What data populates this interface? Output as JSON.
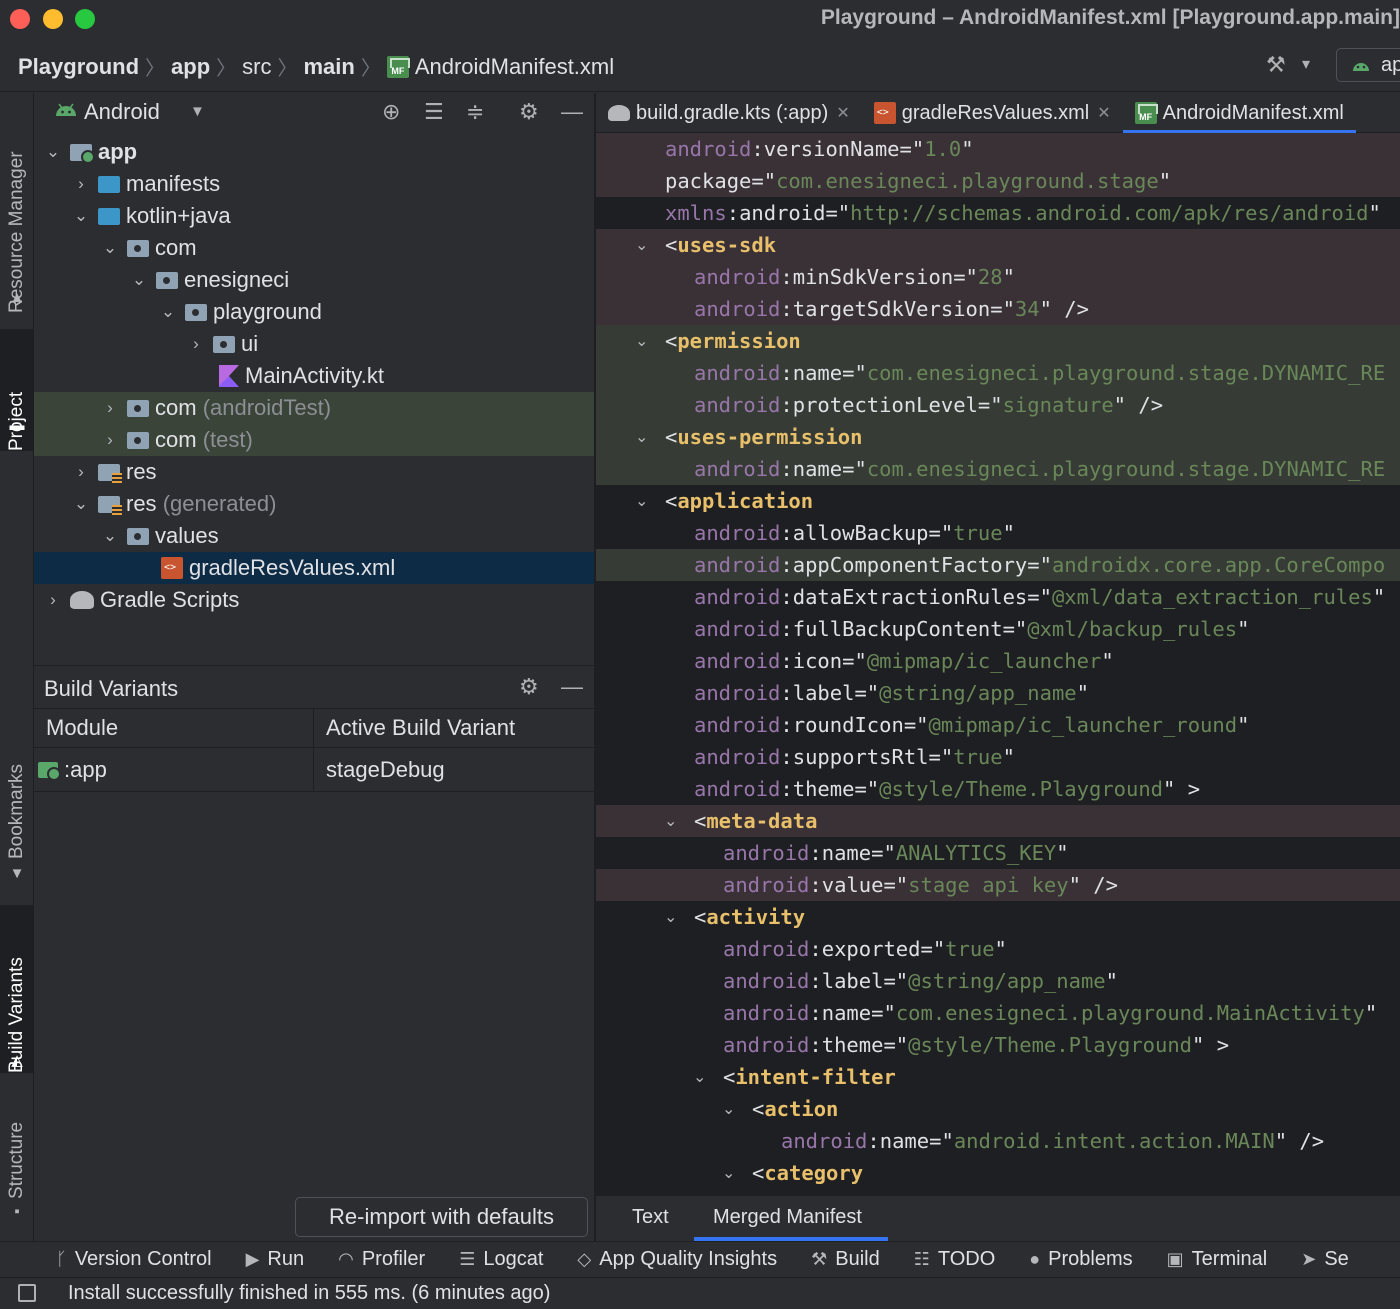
{
  "window": {
    "title": "Playground – AndroidManifest.xml [Playground.app.main]"
  },
  "breadcrumb": [
    "Playground",
    "app",
    "src",
    "main",
    "AndroidManifest.xml"
  ],
  "toolbar_right": {
    "run_config": "app"
  },
  "left_stripe": [
    "Resource Manager",
    "Project",
    "Bookmarks",
    "Build Variants",
    "Structure"
  ],
  "project_panel": {
    "view": "Android",
    "tree": [
      {
        "label": "app",
        "extra": ""
      },
      {
        "label": "manifests",
        "extra": ""
      },
      {
        "label": "kotlin+java",
        "extra": ""
      },
      {
        "label": "com",
        "extra": ""
      },
      {
        "label": "enesigneci",
        "extra": ""
      },
      {
        "label": "playground",
        "extra": ""
      },
      {
        "label": "ui",
        "extra": ""
      },
      {
        "label": "MainActivity.kt",
        "extra": ""
      },
      {
        "label": "com",
        "extra": "(androidTest)"
      },
      {
        "label": "com",
        "extra": "(test)"
      },
      {
        "label": "res",
        "extra": ""
      },
      {
        "label": "res",
        "extra": "(generated)"
      },
      {
        "label": "values",
        "extra": ""
      },
      {
        "label": "gradleResValues.xml",
        "extra": ""
      },
      {
        "label": "Gradle Scripts",
        "extra": ""
      }
    ]
  },
  "build_variants": {
    "title": "Build Variants",
    "columns": [
      "Module",
      "Active Build Variant"
    ],
    "rows": [
      {
        "module": ":app",
        "variant": "stageDebug"
      }
    ],
    "reimport_label": "Re-import with defaults"
  },
  "editor_tabs": [
    {
      "label": "build.gradle.kts (:app)"
    },
    {
      "label": "gradleResValues.xml"
    },
    {
      "label": "AndroidManifest.xml"
    }
  ],
  "code_lines": [
    "android:versionName=\"1.0\"",
    "package=\"com.enesigneci.playground.stage\"",
    "xmlns:android=\"http://schemas.android.com/apk/res/android\"",
    "<uses-sdk",
    "android:minSdkVersion=\"28\"",
    "android:targetSdkVersion=\"34\" />",
    "<permission",
    "android:name=\"com.enesigneci.playground.stage.DYNAMIC_RE",
    "android:protectionLevel=\"signature\" />",
    "<uses-permission",
    "android:name=\"com.enesigneci.playground.stage.DYNAMIC_RE",
    "<application",
    "android:allowBackup=\"true\"",
    "android:appComponentFactory=\"androidx.core.app.CoreCompo",
    "android:dataExtractionRules=\"@xml/data_extraction_rules\"",
    "android:fullBackupContent=\"@xml/backup_rules\"",
    "android:icon=\"@mipmap/ic_launcher\"",
    "android:label=\"@string/app_name\"",
    "android:roundIcon=\"@mipmap/ic_launcher_round\"",
    "android:supportsRtl=\"true\"",
    "android:theme=\"@style/Theme.Playground\" >",
    "<meta-data",
    "android:name=\"ANALYTICS_KEY\"",
    "android:value=\"stage api key\" />",
    "<activity",
    "android:exported=\"true\"",
    "android:label=\"@string/app_name\"",
    "android:name=\"com.enesigneci.playground.MainActivity\"",
    "android:theme=\"@style/Theme.Playground\" >",
    "<intent-filter",
    "<action",
    "android:name=\"android.intent.action.MAIN\" />",
    "<category"
  ],
  "editor_bottom_tabs": [
    "Text",
    "Merged Manifest"
  ],
  "tool_windows": [
    "Version Control",
    "Run",
    "Profiler",
    "Logcat",
    "App Quality Insights",
    "Build",
    "TODO",
    "Problems",
    "Terminal",
    "Se"
  ],
  "status": {
    "message": "Install successfully finished in 555 ms. (6 minutes ago)"
  }
}
